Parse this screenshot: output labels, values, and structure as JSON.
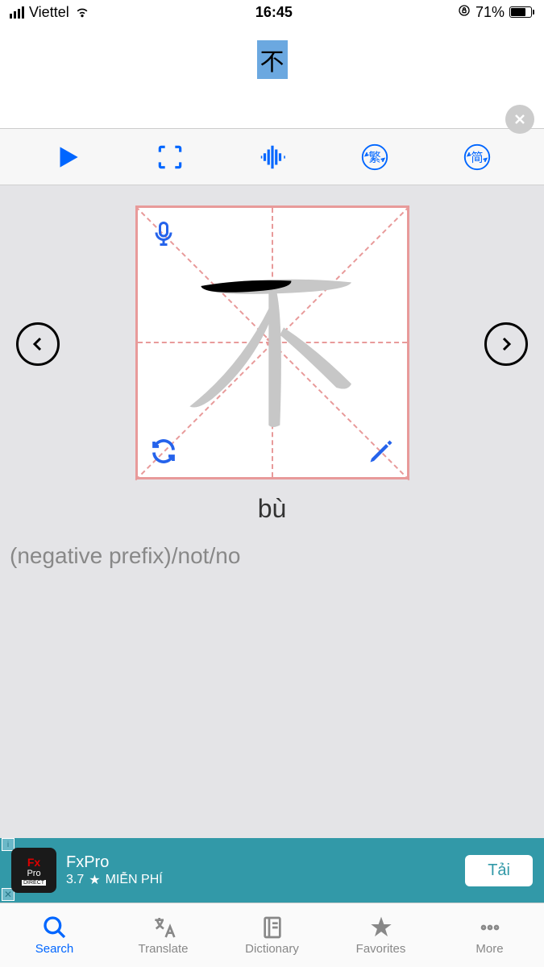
{
  "status_bar": {
    "carrier": "Viettel",
    "time": "16:45",
    "battery_percent": "71%"
  },
  "header": {
    "character": "不"
  },
  "toolbar": {
    "traditional_label": "繁",
    "simplified_label": "简"
  },
  "card": {
    "character": "不",
    "pinyin": "bù",
    "definition": "(negative prefix)/not/no"
  },
  "ad": {
    "title": "FxPro",
    "rating": "3.7",
    "price_label": "MIỄN PHÍ",
    "cta": "Tải"
  },
  "tabs": {
    "search": "Search",
    "translate": "Translate",
    "dictionary": "Dictionary",
    "favorites": "Favorites",
    "more": "More"
  }
}
